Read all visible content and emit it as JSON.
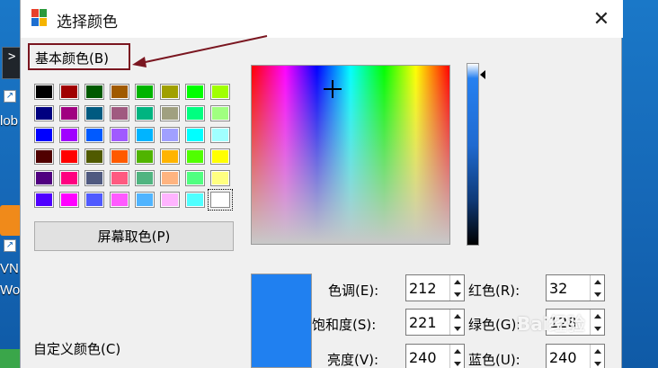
{
  "window": {
    "title": "选择颜色",
    "close_glyph": "✕"
  },
  "desktop": {
    "label_1": "lob",
    "label_2": "VN",
    "label_3": "Wo",
    "icon_glyph": ">"
  },
  "basic_colors": {
    "label": "基本颜色(B)",
    "swatches": [
      "#000000",
      "#a00000",
      "#005a00",
      "#a05a00",
      "#00b400",
      "#a0a000",
      "#00ff00",
      "#a0ff00",
      "#000080",
      "#a00080",
      "#005a80",
      "#a05a80",
      "#00b480",
      "#a0a080",
      "#00ff80",
      "#a0ff80",
      "#0000ff",
      "#a000ff",
      "#005aff",
      "#a05aff",
      "#00b4ff",
      "#a0a0ff",
      "#00ffff",
      "#a0ffff",
      "#500000",
      "#ff0000",
      "#505a00",
      "#ff5a00",
      "#50b400",
      "#ffb400",
      "#50ff00",
      "#ffff00",
      "#500080",
      "#ff0080",
      "#505a80",
      "#ff5a80",
      "#50b480",
      "#ffb480",
      "#50ff80",
      "#ffff80",
      "#5000ff",
      "#ff00ff",
      "#505aff",
      "#ff5aff",
      "#50b4ff",
      "#ffb4ff",
      "#50ffff",
      "#ffffff"
    ],
    "selected_index": 47
  },
  "pick_screen_button": "屏幕取色(P)",
  "custom_colors": {
    "label": "自定义颜色(C)"
  },
  "current_color": "#2080f0",
  "fields": {
    "hue": {
      "label": "色调(E):",
      "value": "212"
    },
    "sat": {
      "label": "饱和度(S):",
      "value": "221"
    },
    "lum": {
      "label": "亮度(V):",
      "value": "240"
    },
    "red": {
      "label": "红色(R):",
      "value": "32"
    },
    "green": {
      "label": "绿色(G):",
      "value": "128"
    },
    "blue": {
      "label": "蓝色(U):",
      "value": "240"
    }
  },
  "watermark": "Bai经验",
  "accent_colors": {
    "annotation": "#7a1620",
    "dialog_bg": "#f0f0f0",
    "desktop": "#1a78c8"
  }
}
